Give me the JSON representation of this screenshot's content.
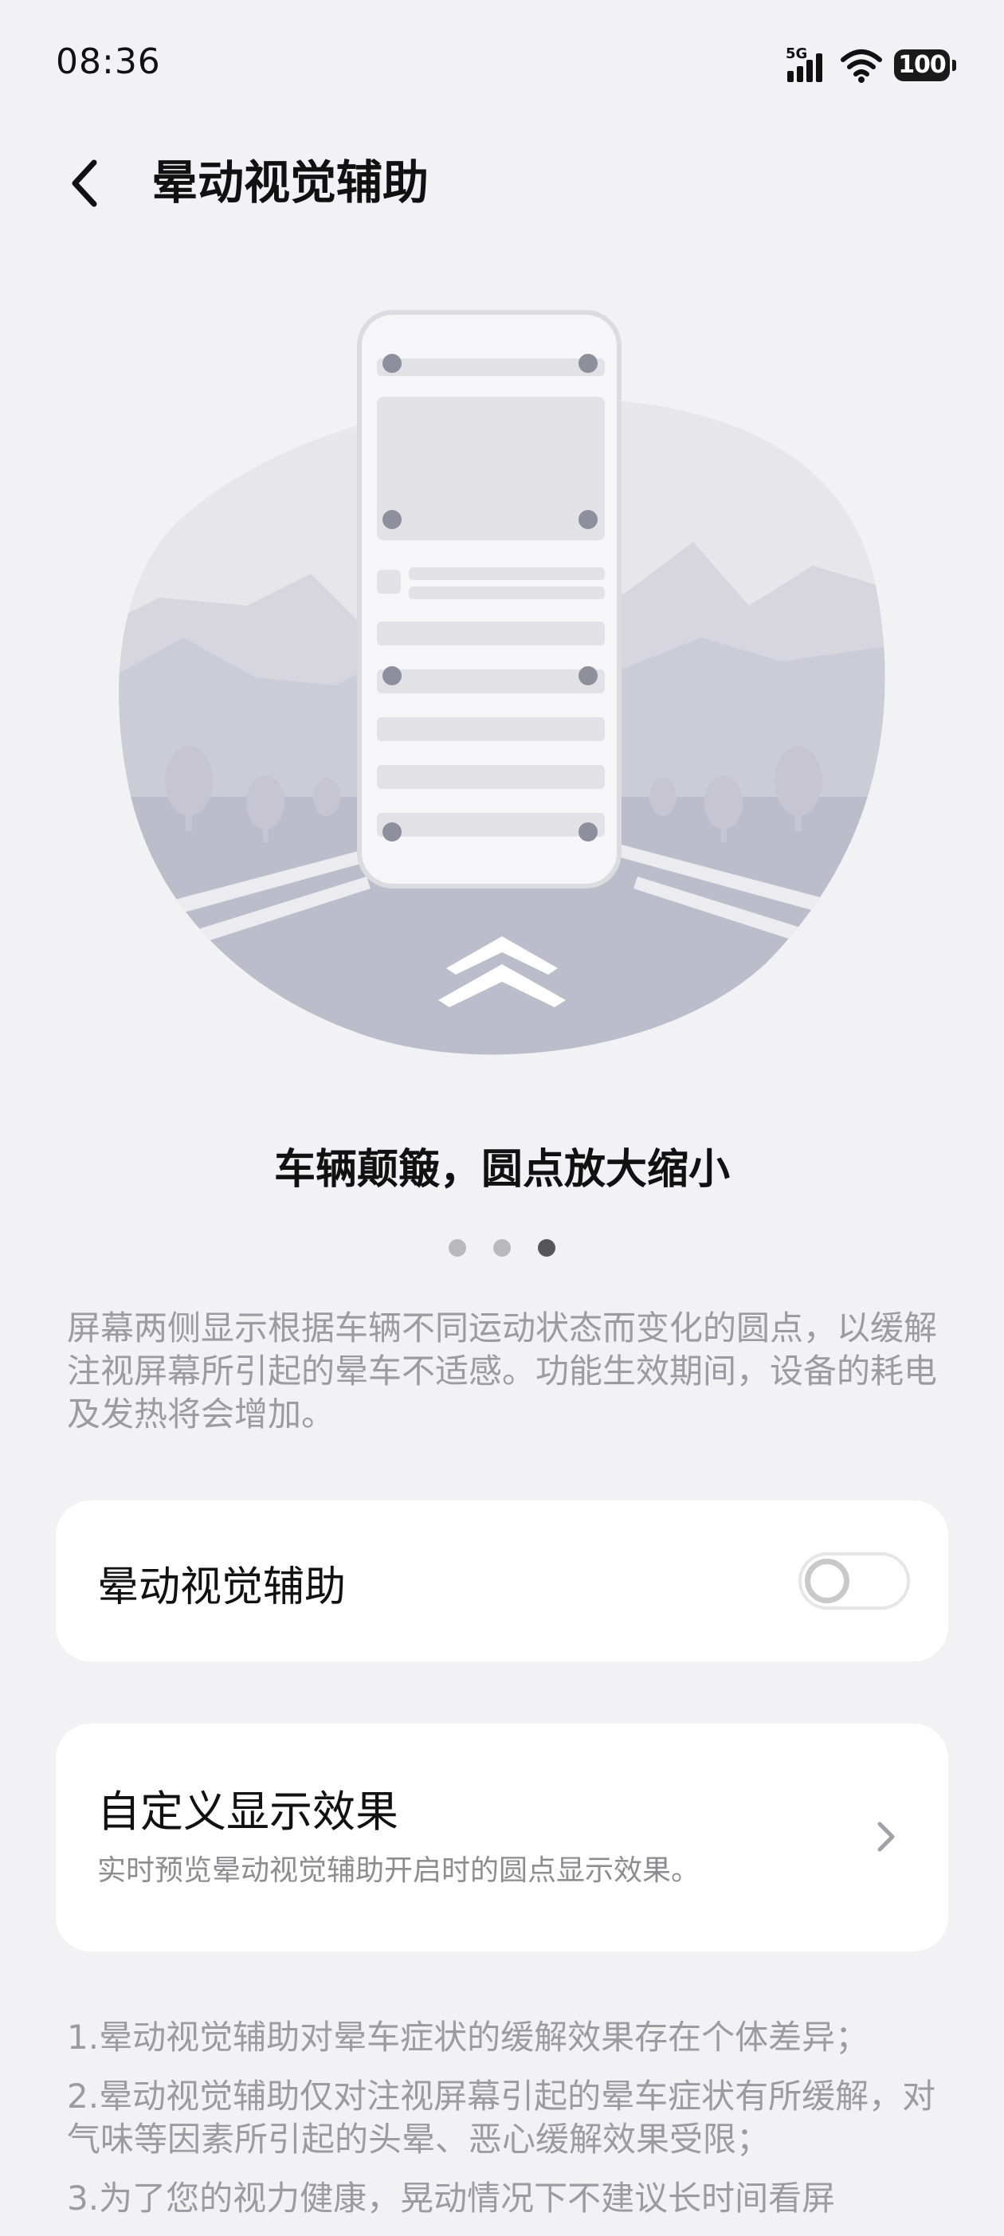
{
  "status_bar": {
    "time": "08:36",
    "network": "5G",
    "battery": "100"
  },
  "header": {
    "title": "晕动视觉辅助"
  },
  "carousel": {
    "title": "车辆颠簸，圆点放大缩小",
    "page_count": 3,
    "active_index": 2
  },
  "description": "屏幕两侧显示根据车辆不同运动状态而变化的圆点，以缓解注视屏幕所引起的晕车不适感。功能生效期间，设备的耗电及发热将会增加。",
  "toggle_card": {
    "label": "晕动视觉辅助",
    "enabled": false
  },
  "custom_card": {
    "title": "自定义显示效果",
    "subtitle": "实时预览晕动视觉辅助开启时的圆点显示效果。"
  },
  "notes": [
    "1.晕动视觉辅助对晕车症状的缓解效果存在个体差异；",
    "2.晕动视觉辅助仅对注视屏幕引起的晕车症状有所缓解，对气味等因素所引起的头晕、恶心缓解效果受限；",
    "3.为了您的视力健康，晃动情况下不建议长时间看屏"
  ],
  "colors": {
    "background": "#f2f2f4",
    "card": "#ffffff",
    "secondary_text": "#9b9ba0",
    "illustration_blob": "#e4e4ea",
    "illustration_road": "#bdbccb"
  },
  "icons": {
    "back": "back-arrow-icon",
    "chevron": "chevron-right-icon",
    "signal": "signal-icon",
    "wifi": "wifi-icon",
    "battery": "battery-icon"
  }
}
